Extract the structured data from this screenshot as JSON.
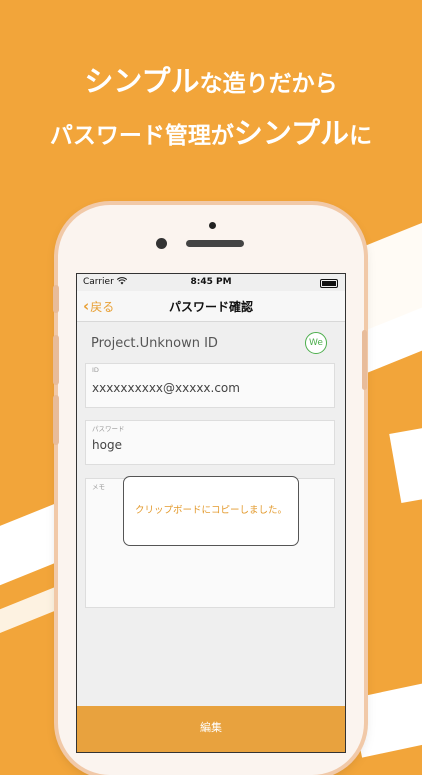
{
  "headline": {
    "line1": {
      "strong": "シンプル",
      "rest": "な造りだから"
    },
    "line2": {
      "pre": "パスワード管理が",
      "strong": "シンプル",
      "post": "に"
    }
  },
  "status_bar": {
    "carrier": "Carrier",
    "time": "8:45 PM"
  },
  "nav": {
    "back_label": "戻る",
    "back_chevron": "‹",
    "title": "パスワード確認"
  },
  "entry": {
    "project_name": "Project.Unknown ID",
    "badge": "We",
    "id_label": "ID",
    "id_value": "xxxxxxxxxx@xxxxx.com",
    "password_label": "パスワード",
    "password_value": "hoge",
    "memo_label": "メモ"
  },
  "toast": {
    "message": "クリップボードにコピーしました。"
  },
  "footer": {
    "edit_label": "編集"
  },
  "colors": {
    "background": "#F2A53A",
    "accent": "#E8A035",
    "badge": "#4cae4c"
  }
}
